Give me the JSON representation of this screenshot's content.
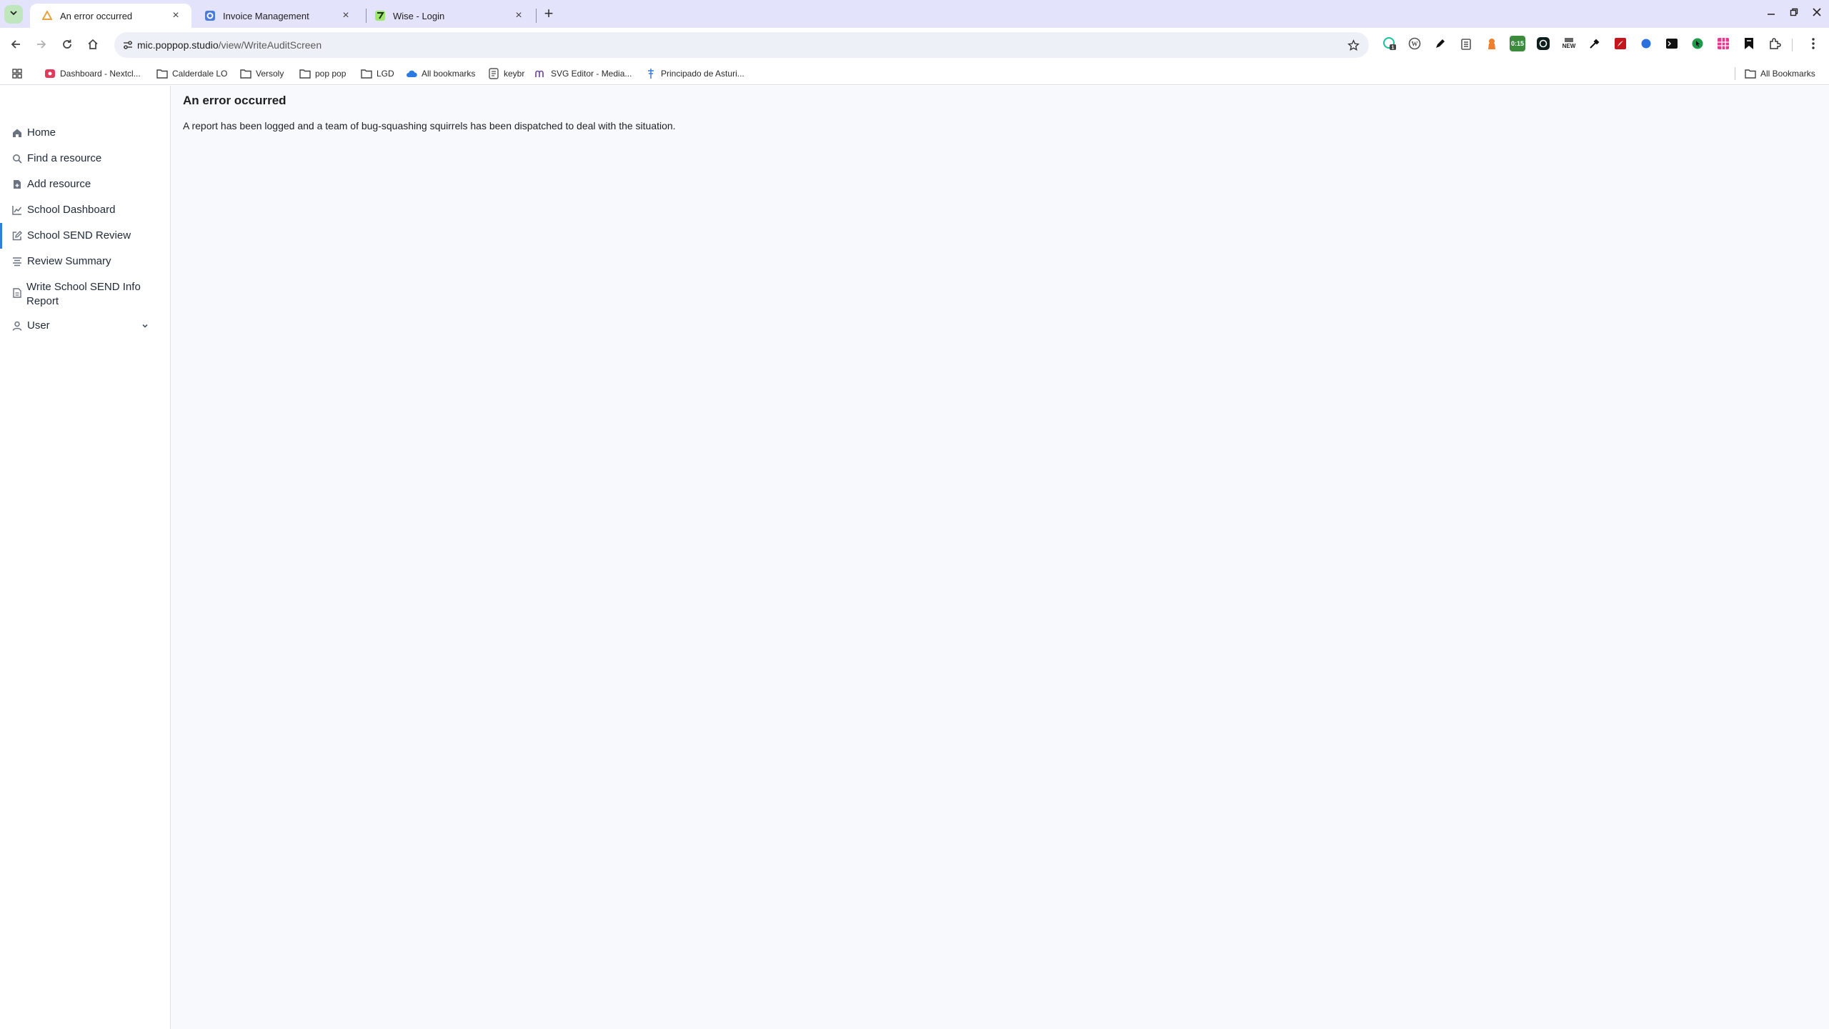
{
  "browser": {
    "tabs": [
      {
        "title": "An error occurred",
        "active": true,
        "favicon": "poppop-icon"
      },
      {
        "title": "Invoice Management",
        "active": false,
        "favicon": "invoice-icon"
      },
      {
        "title": "Wise - Login",
        "active": false,
        "favicon": "wise-icon"
      }
    ],
    "url_host": "mic.poppop.studio",
    "url_path": "/view/WriteAuditScreen",
    "extensions": [
      "grammarly-icon",
      "wordpress-icon",
      "pen-icon",
      "clipboard-icon",
      "ghost-icon",
      "timer-icon",
      "chatgpt-icon",
      "new-icon",
      "eyedropper-icon",
      "pdf-icon",
      "blue-circle-icon",
      "terminal-icon",
      "cursor-icon",
      "grid-icon",
      "bookmark-icon",
      "puzzle-icon"
    ],
    "extension_badges": {
      "timer": "0:15",
      "new": "NEW",
      "grammarly": "1"
    }
  },
  "bookmarks": {
    "items": [
      {
        "label": "Dashboard - Nextcl...",
        "icon": "nextcloud-icon"
      },
      {
        "label": "Calderdale LO",
        "icon": "folder-icon"
      },
      {
        "label": "Versoly",
        "icon": "folder-icon"
      },
      {
        "label": "pop pop",
        "icon": "folder-icon"
      },
      {
        "label": "LGD",
        "icon": "folder-icon"
      },
      {
        "label": "All bookmarks",
        "icon": "cloud-icon"
      },
      {
        "label": "keybr",
        "icon": "keybr-icon"
      },
      {
        "label": "SVG Editor - Media...",
        "icon": "svg-editor-icon"
      },
      {
        "label": "Principado de Asturi...",
        "icon": "asturias-icon"
      }
    ],
    "all_bookmarks": "All Bookmarks"
  },
  "sidebar": {
    "items": [
      {
        "label": "Home",
        "icon": "home-icon"
      },
      {
        "label": "Find a resource",
        "icon": "search-icon"
      },
      {
        "label": "Add resource",
        "icon": "file-plus-icon"
      },
      {
        "label": "School Dashboard",
        "icon": "chart-line-icon"
      },
      {
        "label": "School SEND Review",
        "icon": "edit-icon",
        "active": true
      },
      {
        "label": "Review Summary",
        "icon": "list-icon"
      },
      {
        "label": "Write School SEND Info Report",
        "icon": "document-icon"
      },
      {
        "label": "User",
        "icon": "user-icon"
      }
    ]
  },
  "main": {
    "title": "An error occurred",
    "message": "A report has been logged and a team of bug-squashing squirrels has been dispatched to deal with the situation."
  },
  "colors": {
    "tabstrip": "#e3e3fb",
    "page_bg": "#f8f9fd",
    "active_nav_accent": "#2f7de1"
  }
}
